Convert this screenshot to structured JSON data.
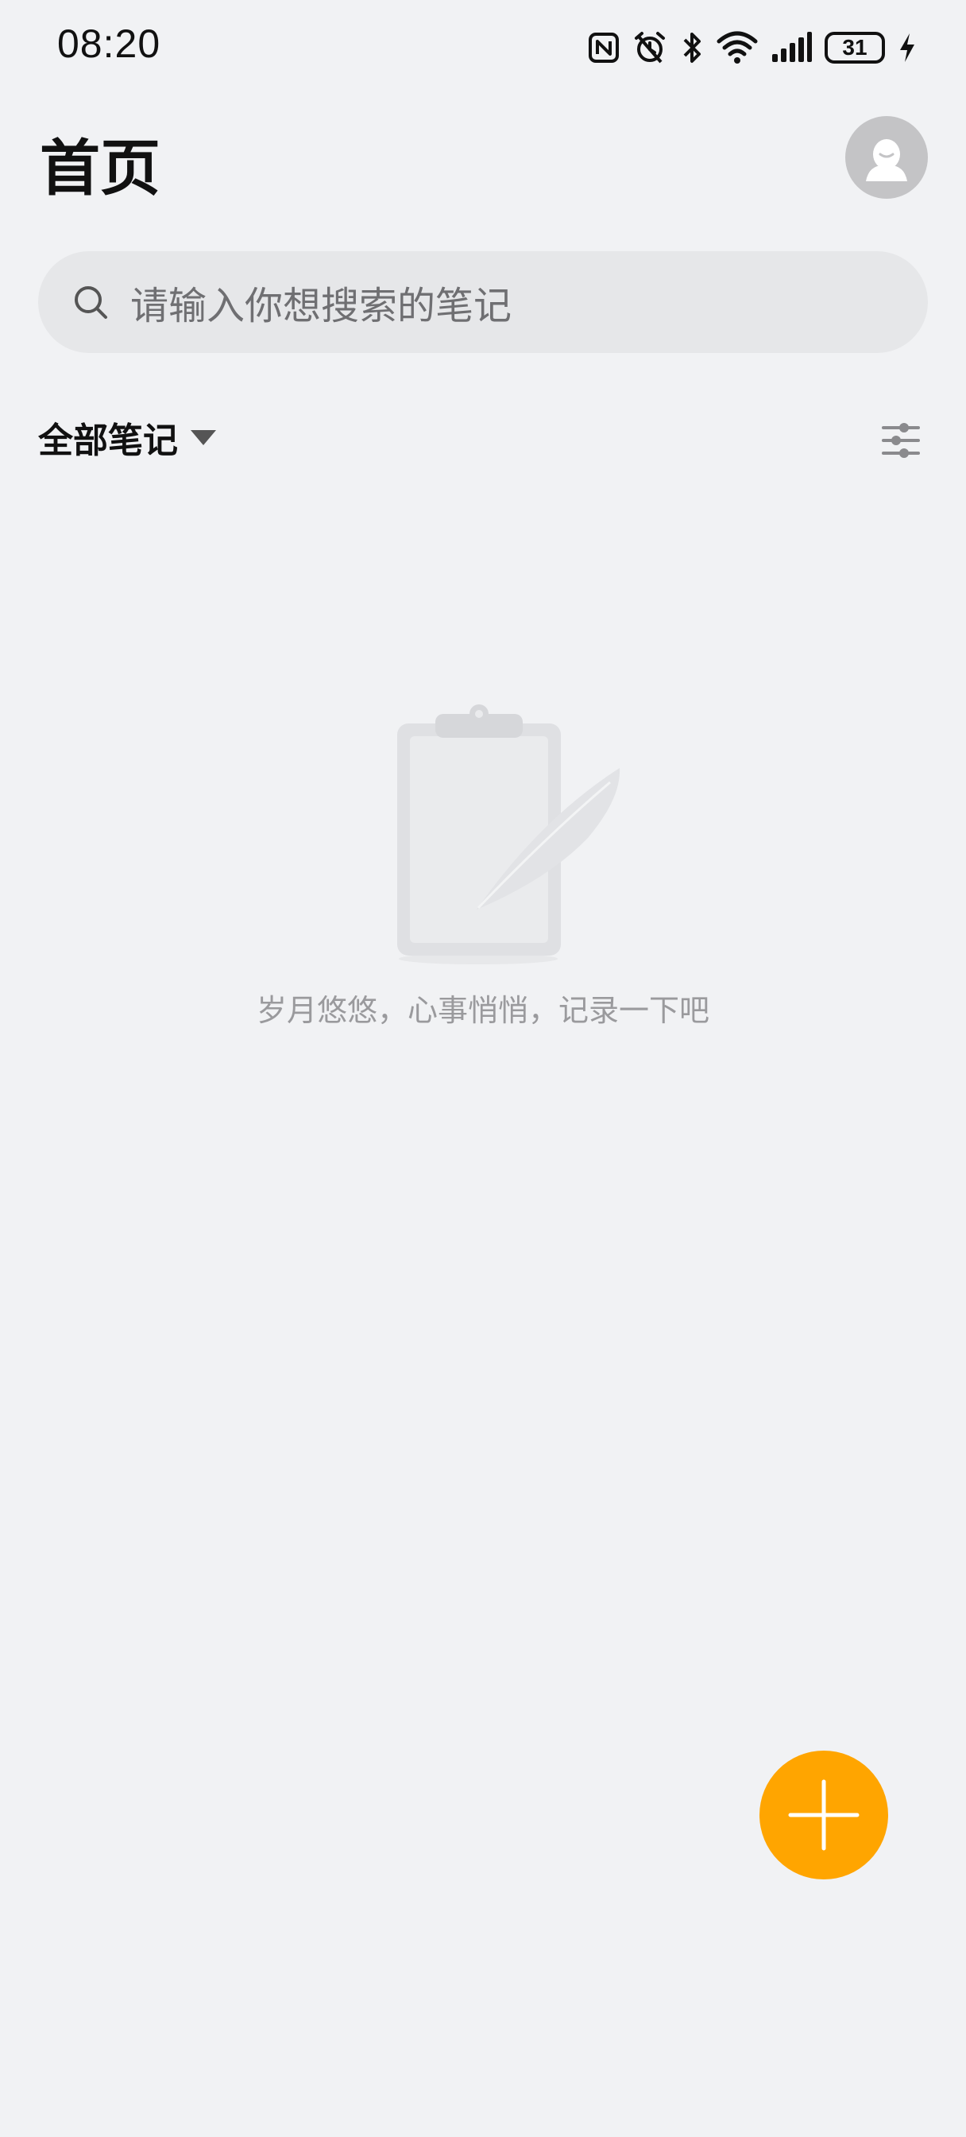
{
  "status_bar": {
    "time": "08:20",
    "battery_level": "31",
    "icons": [
      "nfc-icon",
      "alarm-icon",
      "bluetooth-icon",
      "wifi-icon",
      "signal-icon",
      "battery-icon",
      "charging-icon"
    ]
  },
  "header": {
    "title": "首页",
    "avatar_icon": "user-avatar-icon"
  },
  "search": {
    "placeholder": "请输入你想搜索的笔记",
    "icon": "search-icon"
  },
  "filter": {
    "label": "全部笔记",
    "dropdown_icon": "triangle-down-icon",
    "sort_icon": "sliders-icon"
  },
  "empty_state": {
    "illustration": "clipboard-feather-icon",
    "message": "岁月悠悠，心事悄悄，记录一下吧"
  },
  "fab": {
    "icon": "plus-icon"
  },
  "colors": {
    "background": "#f1f2f4",
    "search_bg": "#e6e7e9",
    "accent": "#ffa500",
    "avatar_bg": "#c4c4c6",
    "muted_text": "#9a9a9d"
  }
}
